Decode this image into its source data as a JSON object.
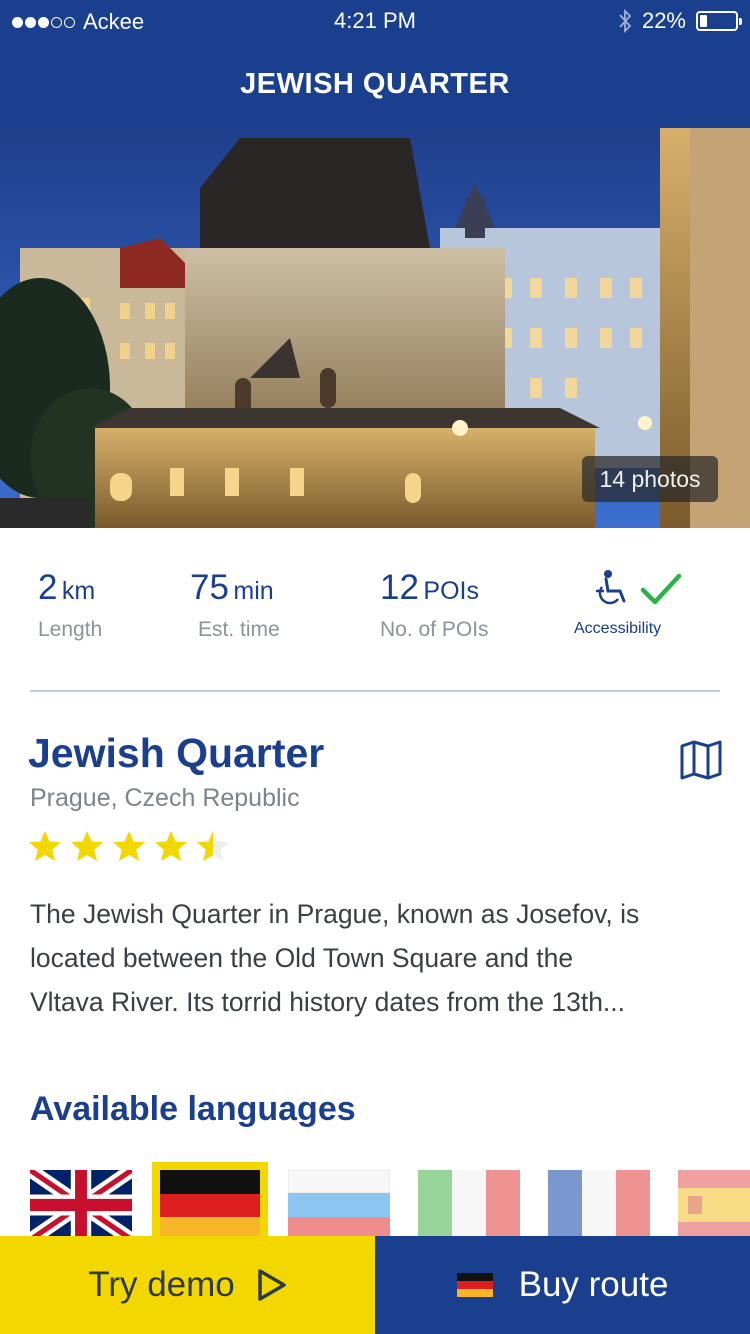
{
  "status_bar": {
    "carrier": "Ackee",
    "time": "4:21 PM",
    "battery": "22%",
    "battery_level": 0.22
  },
  "nav": {
    "title": "JEWISH QUARTER"
  },
  "hero": {
    "photos_label": "14 photos"
  },
  "stats": {
    "length": {
      "value": "2",
      "unit": "km",
      "label": "Length"
    },
    "time": {
      "value": "75",
      "unit": "min",
      "label": "Est. time"
    },
    "pois": {
      "value": "12",
      "unit": "POIs",
      "label": "No. of POIs"
    },
    "accessibility": {
      "label": "Accessibility",
      "accessible": true
    }
  },
  "route": {
    "title": "Jewish Quarter",
    "location": "Prague, Czech Republic",
    "rating": 4.5,
    "rating_max": 5,
    "description_lines": [
      "The Jewish Quarter in Prague, known as Josefov, is",
      "located between the Old Town Square and the",
      "Vltava River. Its torrid history dates from the 13th..."
    ]
  },
  "languages": {
    "title": "Available languages",
    "items": [
      {
        "code": "en",
        "selected": false
      },
      {
        "code": "de",
        "selected": true
      },
      {
        "code": "ru",
        "selected": false
      },
      {
        "code": "it",
        "selected": false
      },
      {
        "code": "fr",
        "selected": false
      },
      {
        "code": "es",
        "selected": false
      }
    ]
  },
  "actions": {
    "demo_label": "Try demo",
    "buy_label": "Buy route"
  },
  "colors": {
    "brand_blue": "#1b3f8f",
    "accent_yellow": "#f2d800",
    "star": "#f2d800",
    "check_green": "#2bb34a"
  }
}
